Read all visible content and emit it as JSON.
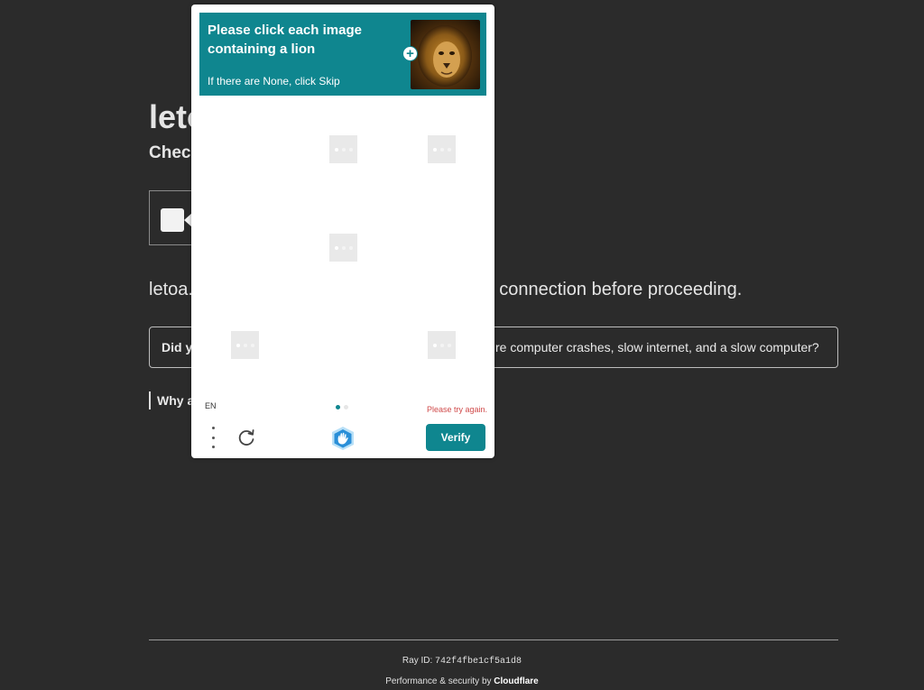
{
  "page": {
    "title_visible": "leto",
    "subtitle_visible": "Chec",
    "review_visible_left": "letoa.",
    "review_visible_right": "ur connection before proceeding.",
    "faq_visible_left": "Did y",
    "faq_visible_right": "re computer crashes, slow internet, and a slow computer?",
    "why_link_visible": "Why a"
  },
  "footer": {
    "ray_label": "Ray ID:",
    "ray_id": "742f4fbe1cf5a1d8",
    "performance_prefix": "Performance & security by",
    "provider": "Cloudflare"
  },
  "captcha": {
    "prompt_title": "Please click each image containing a lion",
    "prompt_hint": "If there are None, click Skip",
    "example_image": "lion-photo",
    "language": "EN",
    "error_message": "Please try again.",
    "verify_label": "Verify",
    "page_indicator": {
      "current": 1,
      "total": 2
    },
    "icons": [
      "plus-icon",
      "more-options-icon",
      "refresh-icon",
      "hcaptcha-logo-icon"
    ],
    "accent_color": "#0f868f",
    "error_color": "#d04a4a"
  }
}
